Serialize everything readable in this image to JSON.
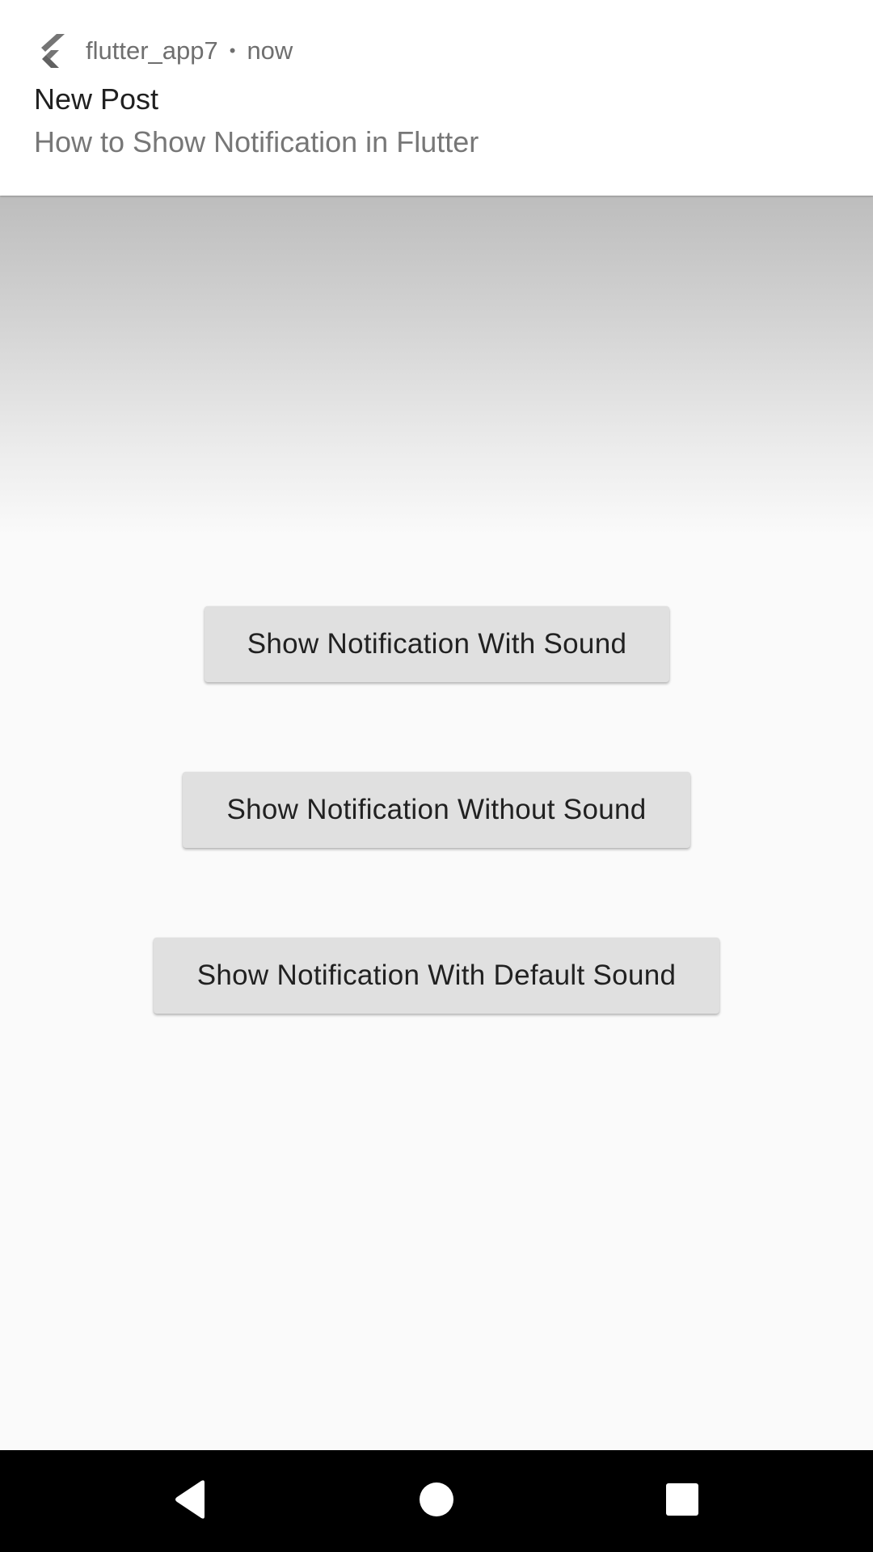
{
  "notification": {
    "app_name": "flutter_app7",
    "separator": "•",
    "time": "now",
    "title": "New Post",
    "body": "How to Show Notification in Flutter",
    "app_icon": "flutter-logo-icon"
  },
  "buttons": {
    "with_sound": "Show Notification With Sound",
    "without_sound": "Show Notification Without Sound",
    "default_sound": "Show Notification With Default Sound"
  },
  "navbar": {
    "back_icon": "back-triangle-icon",
    "home_icon": "home-circle-icon",
    "recents_icon": "recents-square-icon"
  },
  "colors": {
    "background": "#fafafa",
    "button": "#e0e0e0",
    "navbar": "#000000"
  }
}
